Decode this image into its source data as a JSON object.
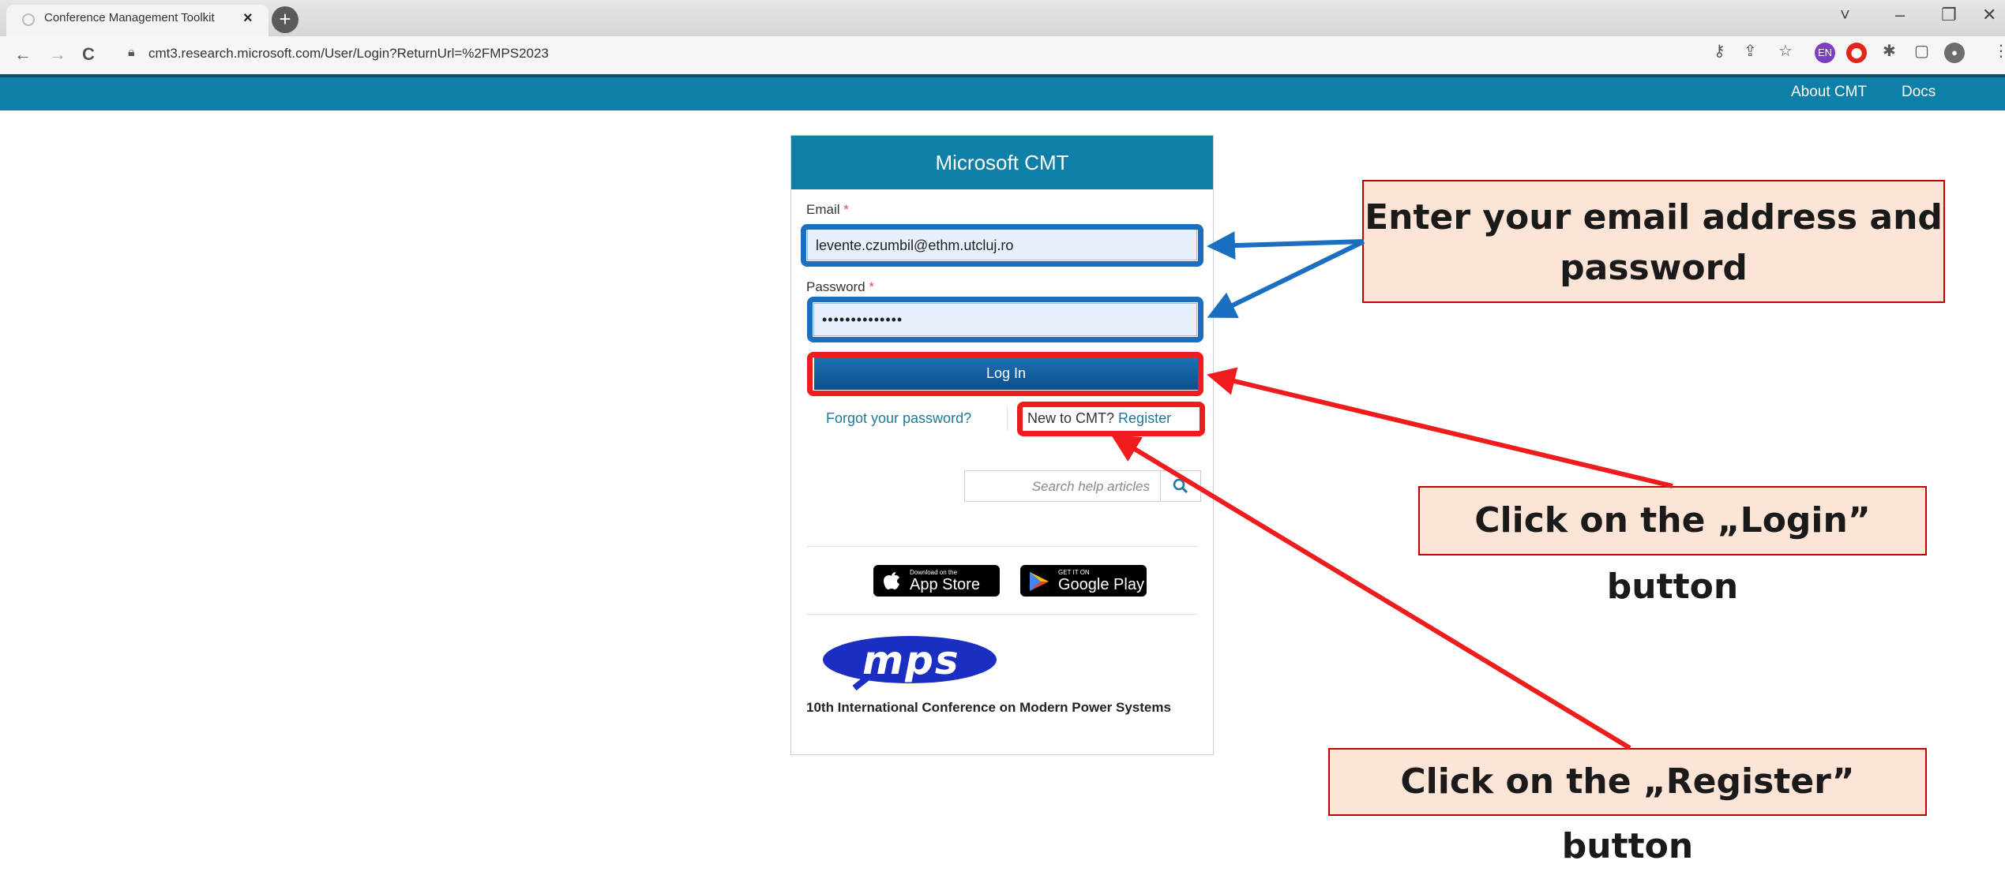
{
  "browser": {
    "tab_title": "Conference Management Toolkit",
    "tab_close": "×",
    "new_tab": "+",
    "url": "cmt3.research.microsoft.com/User/Login?ReturnUrl=%2FMPS2023",
    "back_icon": "←",
    "forward_icon": "→",
    "reload_icon": "C",
    "ext_badge": "EN"
  },
  "site_header": {
    "about_label": "About CMT",
    "docs_label": "Docs",
    "color": "#0e7fa6"
  },
  "login": {
    "title": "Microsoft CMT",
    "email_label": "Email",
    "email_value": "levente.czumbil@ethm.utcluj.ro",
    "password_label": "Password",
    "password_value": "••••••••••••••",
    "required_mark": "*",
    "login_button": "Log In",
    "forgot_link": "Forgot your password?",
    "new_prefix": "New to CMT?",
    "register_link": "Register",
    "search_placeholder": "Search help articles"
  },
  "stores": {
    "apple_small": "Download on the",
    "apple_big": "App Store",
    "google_small": "GET IT ON",
    "google_big": "Google Play"
  },
  "conference": {
    "logo_text": "mps",
    "name": "10th International Conference on Modern Power Systems"
  },
  "annotations": {
    "credentials": "Enter your email address and password",
    "login": "Click on the „Login” button",
    "register": "Click on the „Register” button"
  },
  "colors": {
    "highlight_blue": "#1a6fc0",
    "highlight_red": "#ee1c1c",
    "callout_fill": "#fce4d6"
  }
}
